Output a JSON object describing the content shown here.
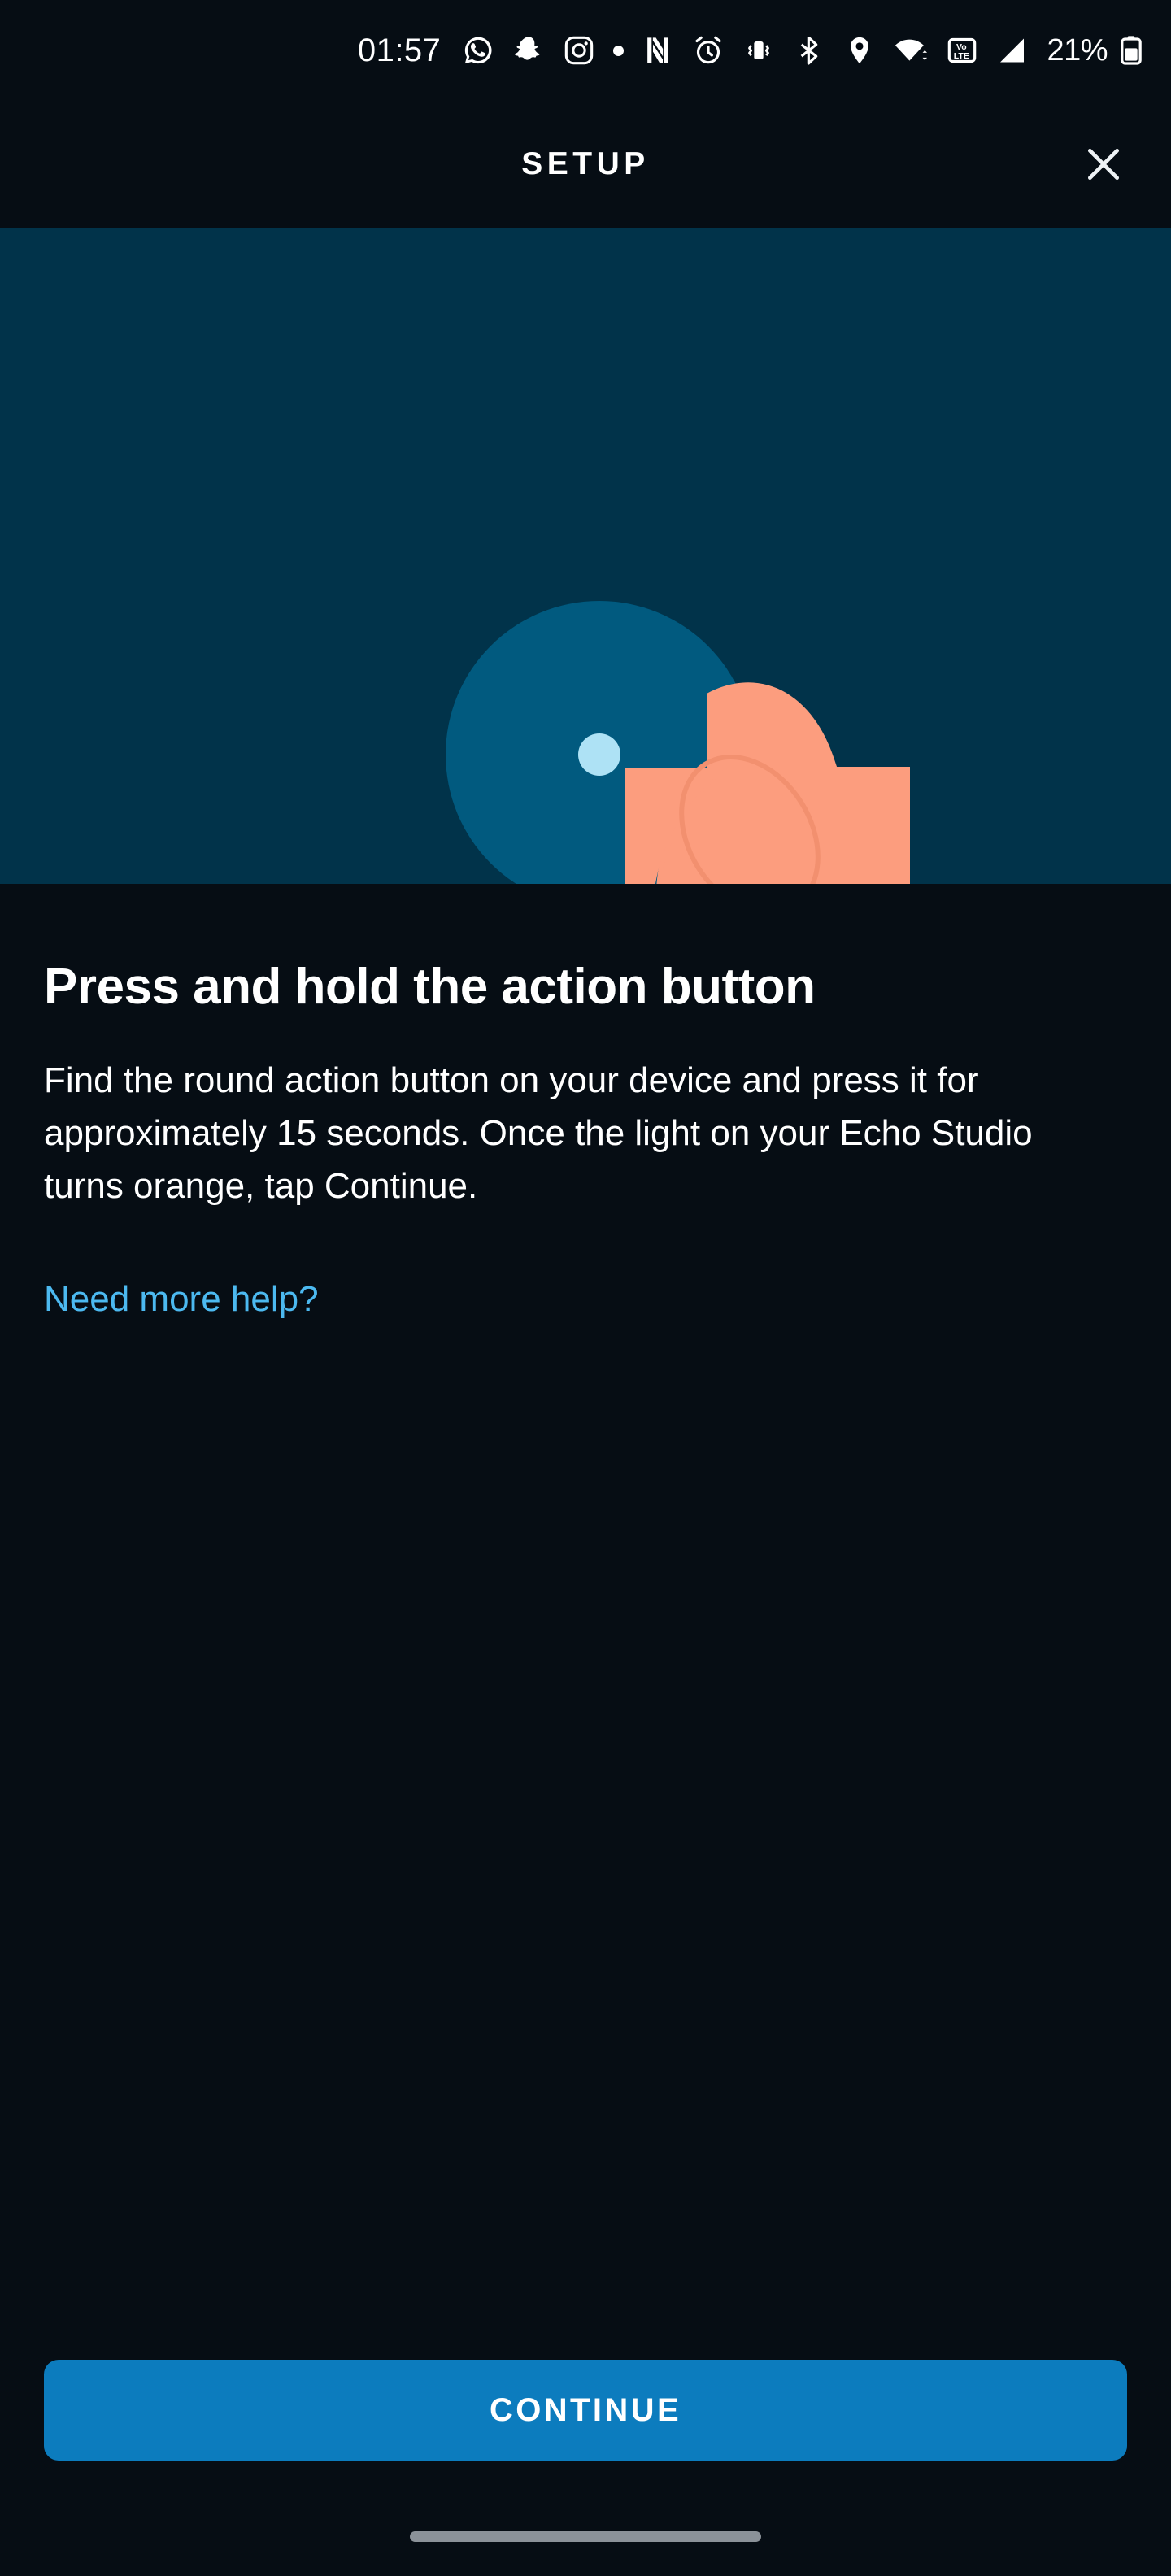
{
  "status_bar": {
    "time": "01:57",
    "battery_percent": "21%",
    "notification_icons": [
      "whatsapp-icon",
      "snapchat-icon",
      "instagram-icon",
      "notification-dot-icon"
    ],
    "system_icons": [
      "nfc-icon",
      "alarm-icon",
      "vibrate-icon",
      "bluetooth-icon",
      "location-icon",
      "wifi-icon",
      "volte-icon",
      "signal-icon",
      "battery-icon"
    ],
    "volte_label_top": "Vo",
    "volte_label_bottom": "LTE"
  },
  "header": {
    "title": "SETUP",
    "close_icon": "close-icon"
  },
  "hero": {
    "illustration_name": "finger-pressing-action-button",
    "background_color": "#01334a",
    "circle_color": "#015a7f",
    "led_dot_color": "#aee2f5",
    "finger_color": "#fc9d7e",
    "nail_outline_color": "#f2906f"
  },
  "main": {
    "heading": "Press and hold the action button",
    "body": "Find the round action button on your device and press it for approximately 15 seconds. Once the light on your Echo Studio turns orange, tap Continue.",
    "help_link": "Need more help?",
    "help_link_color": "#4cb9f0"
  },
  "footer": {
    "continue_label": "CONTINUE",
    "continue_color": "#0c7cbe"
  }
}
